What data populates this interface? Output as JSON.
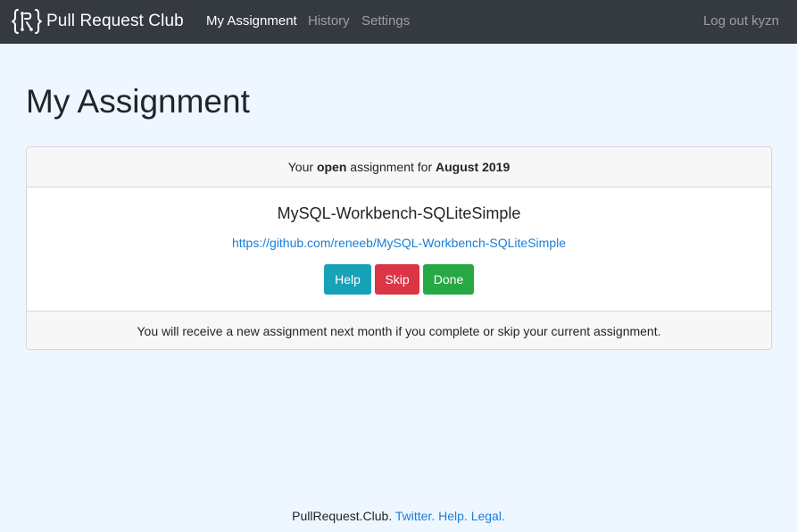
{
  "nav": {
    "brand": "Pull Request Club",
    "brand_icon": "pr-club-logo-icon",
    "links": {
      "my_assignment": "My Assignment",
      "history": "History",
      "settings": "Settings"
    },
    "logout": "Log out kyzn"
  },
  "page": {
    "title": "My Assignment"
  },
  "card": {
    "header": {
      "prefix": "Your",
      "status": "open",
      "middle": "assignment for",
      "period": "August 2019"
    },
    "repo_name": "MySQL-Workbench-SQLiteSimple",
    "repo_url": "https://github.com/reneeb/MySQL-Workbench-SQLiteSimple",
    "buttons": {
      "help": "Help",
      "skip": "Skip",
      "done": "Done"
    },
    "footer_note": "You will receive a new assignment next month if you complete or skip your current assignment."
  },
  "footer": {
    "site": "PullRequest.Club.",
    "twitter": "Twitter.",
    "help": "Help.",
    "legal": "Legal."
  },
  "colors": {
    "navbar": "#343a40",
    "page_bg": "#eef6ff",
    "link": "#1a7ed8",
    "help_button": "#17a2b8",
    "skip_button": "#dc3545",
    "done_button": "#28a745"
  }
}
